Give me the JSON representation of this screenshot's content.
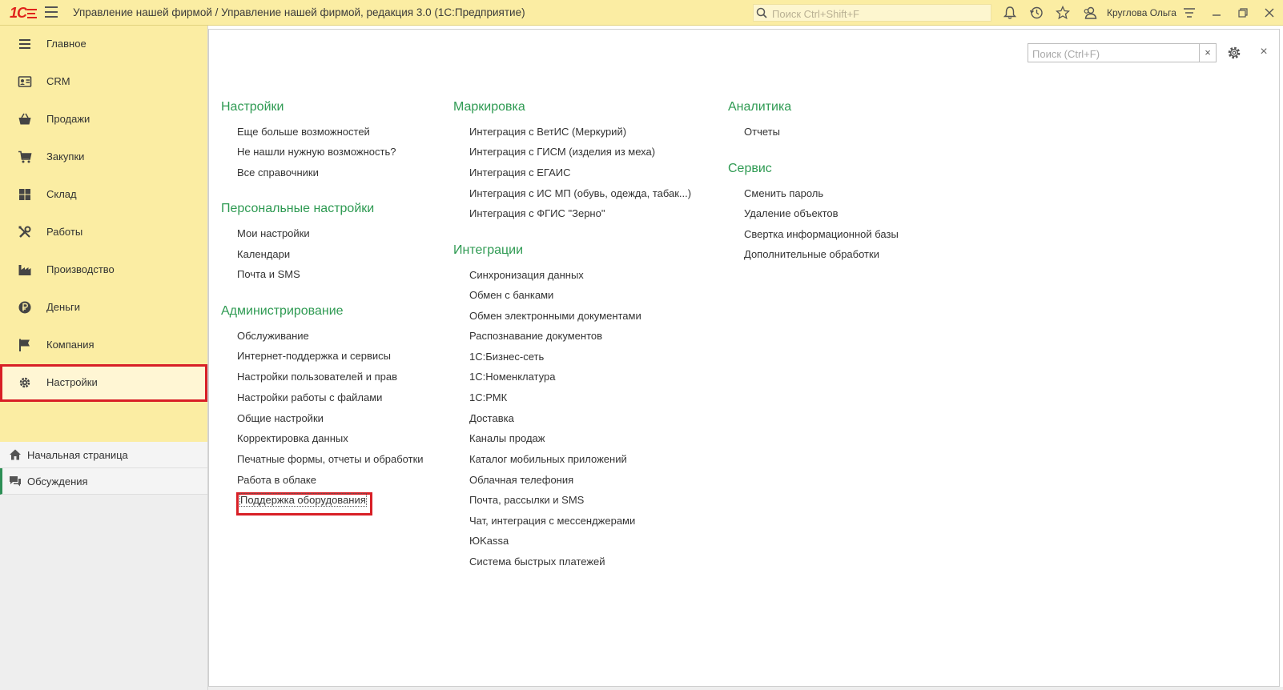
{
  "titlebar": {
    "logo_text": "1С",
    "app_title": "Управление нашей фирмой / Управление нашей фирмой, редакция 3.0  (1С:Предприятие)",
    "search_placeholder": "Поиск Ctrl+Shift+F",
    "user_name": "Круглова Ольга",
    "icons": [
      "menu-icon",
      "search-icon",
      "bell-icon",
      "history-icon",
      "star-icon",
      "user-icon",
      "settings-lines-icon",
      "minimize-icon",
      "restore-icon",
      "close-icon"
    ]
  },
  "sidebar": {
    "sections": [
      {
        "label": "Главное",
        "icon": "list-icon"
      },
      {
        "label": "CRM",
        "icon": "contacts-icon"
      },
      {
        "label": "Продажи",
        "icon": "basket-icon"
      },
      {
        "label": "Закупки",
        "icon": "cart-icon"
      },
      {
        "label": "Склад",
        "icon": "warehouse-icon"
      },
      {
        "label": "Работы",
        "icon": "tools-icon"
      },
      {
        "label": "Производство",
        "icon": "factory-icon"
      },
      {
        "label": "Деньги",
        "icon": "ruble-icon"
      },
      {
        "label": "Компания",
        "icon": "flag-icon"
      },
      {
        "label": "Настройки",
        "icon": "gear-icon",
        "active": true
      }
    ],
    "bottom": [
      {
        "label": "Начальная страница",
        "icon": "home-icon"
      },
      {
        "label": "Обсуждения",
        "icon": "chat-icon",
        "selected": true
      }
    ]
  },
  "main": {
    "search_placeholder": "Поиск (Ctrl+F)",
    "clear_label": "×",
    "close_label": "×",
    "columns": [
      {
        "groups": [
          {
            "title": "Настройки",
            "items": [
              "Еще больше возможностей",
              "Не нашли нужную возможность?",
              "Все справочники"
            ]
          },
          {
            "title": "Персональные настройки",
            "items": [
              "Мои настройки",
              "Календари",
              "Почта и SMS"
            ]
          },
          {
            "title": "Администрирование",
            "items": [
              "Обслуживание",
              "Интернет-поддержка и сервисы",
              "Настройки пользователей и прав",
              "Настройки работы с файлами",
              "Общие настройки",
              "Корректировка данных",
              "Печатные формы, отчеты и обработки",
              "Работа в облаке",
              "Поддержка оборудования"
            ]
          }
        ]
      },
      {
        "groups": [
          {
            "title": "Маркировка",
            "items": [
              "Интеграция с ВетИС (Меркурий)",
              "Интеграция с ГИСМ (изделия из меха)",
              "Интеграция с ЕГАИС",
              "Интеграция с ИС МП (обувь, одежда, табак...)",
              "Интеграция с ФГИС \"Зерно\""
            ]
          },
          {
            "title": "Интеграции",
            "items": [
              "Синхронизация данных",
              "Обмен с банками",
              "Обмен электронными документами",
              "Распознавание документов",
              "1С:Бизнес-сеть",
              "1С:Номенклатура",
              "1С:РМК",
              "Доставка",
              "Каналы продаж",
              "Каталог мобильных приложений",
              "Облачная телефония",
              "Почта, рассылки и SMS",
              "Чат, интеграция с мессенджерами",
              "ЮKassa",
              "Система быстрых платежей"
            ]
          }
        ]
      },
      {
        "groups": [
          {
            "title": "Аналитика",
            "items": [
              "Отчеты"
            ]
          },
          {
            "title": "Сервис",
            "items": [
              "Сменить пароль",
              "Удаление объектов",
              "Свертка информационной базы",
              "Дополнительные обработки"
            ]
          }
        ]
      }
    ]
  },
  "colors": {
    "titlebar_bg": "#fbeda3",
    "group_title": "#2e9a52",
    "highlight_frame": "#d81f26",
    "logo": "#e0231c"
  }
}
